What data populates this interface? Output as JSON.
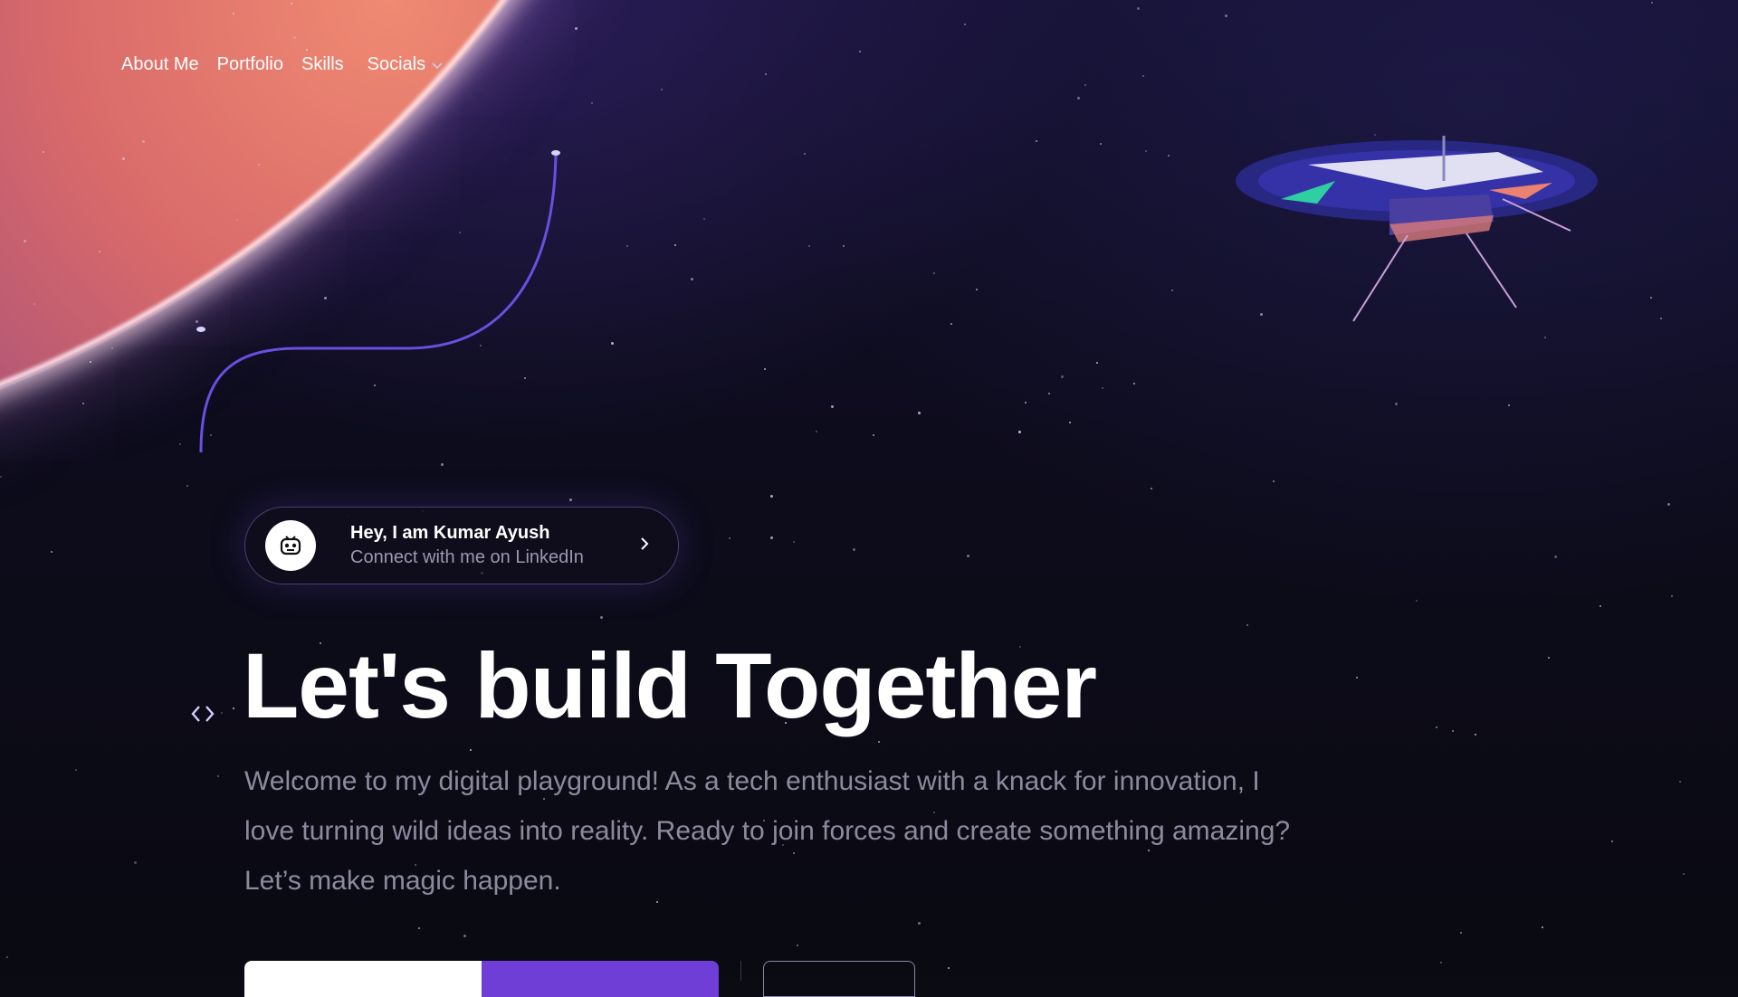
{
  "nav": {
    "items": [
      {
        "label": "About Me"
      },
      {
        "label": "Portfolio"
      },
      {
        "label": "Skills"
      },
      {
        "label": "Socials"
      }
    ],
    "socials_icon": "chevron-down-icon"
  },
  "intro": {
    "title": "Hey, I am Kumar Ayush",
    "subtitle": "Connect with me on LinkedIn",
    "avatar_icon": "robot-face-icon",
    "action_icon": "chevron-right-icon"
  },
  "hero": {
    "headline": "Let's build Together",
    "lead": "Welcome to my digital playground! As a tech enthusiast with a knack for innovation, I love turning wild ideas into reality. Ready to join forces and create something amazing? Let’s make magic happen.",
    "marker_icon": "code-brackets-icon"
  },
  "colors": {
    "accent": "#6e3ed6",
    "text_muted": "#8d8a9e",
    "background": "#0b0b14"
  }
}
